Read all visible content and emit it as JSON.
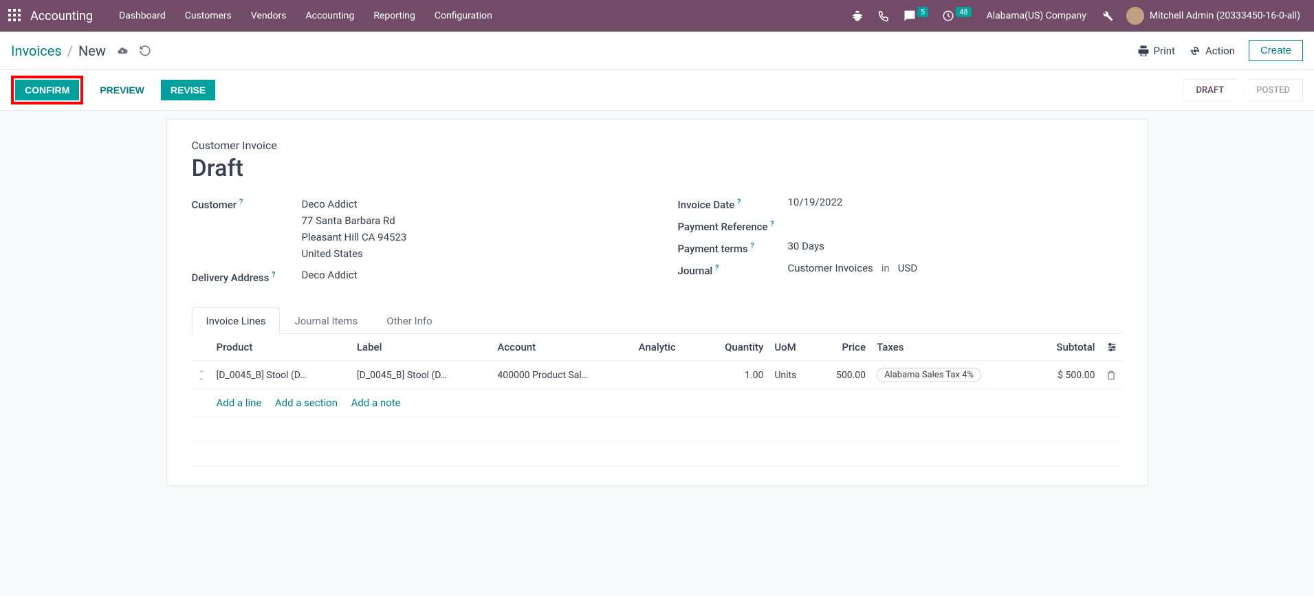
{
  "navbar": {
    "brand": "Accounting",
    "menus": [
      "Dashboard",
      "Customers",
      "Vendors",
      "Accounting",
      "Reporting",
      "Configuration"
    ],
    "messages_count": "5",
    "activities_count": "48",
    "company": "Alabama(US) Company",
    "user": "Mitchell Admin (20333450-16-0-all)"
  },
  "breadcrumb": {
    "back": "Invoices",
    "current": "New"
  },
  "control": {
    "print": "Print",
    "action": "Action",
    "create": "Create"
  },
  "statusbar": {
    "confirm": "CONFIRM",
    "preview": "PREVIEW",
    "revise": "REVISE",
    "draft": "DRAFT",
    "posted": "POSTED"
  },
  "form": {
    "move_type": "Customer Invoice",
    "name": "Draft",
    "labels": {
      "customer": "Customer",
      "delivery": "Delivery Address",
      "invoice_date": "Invoice Date",
      "payment_ref": "Payment Reference",
      "payment_terms": "Payment terms",
      "journal": "Journal",
      "in": "in"
    },
    "customer": {
      "name": "Deco Addict",
      "street": "77 Santa Barbara Rd",
      "city": "Pleasant Hill CA 94523",
      "country": "United States"
    },
    "delivery": "Deco Addict",
    "invoice_date": "10/19/2022",
    "payment_ref": "",
    "payment_terms": "30 Days",
    "journal": "Customer Invoices",
    "currency": "USD"
  },
  "tabs": [
    "Invoice Lines",
    "Journal Items",
    "Other Info"
  ],
  "columns": {
    "product": "Product",
    "label": "Label",
    "account": "Account",
    "analytic": "Analytic",
    "quantity": "Quantity",
    "uom": "UoM",
    "price": "Price",
    "taxes": "Taxes",
    "subtotal": "Subtotal"
  },
  "lines": [
    {
      "product": "[D_0045_B] Stool (D…",
      "label": "[D_0045_B] Stool (D…",
      "account": "400000 Product Sal…",
      "analytic": "",
      "quantity": "1.00",
      "uom": "Units",
      "price": "500.00",
      "tax": "Alabama Sales Tax 4%",
      "subtotal": "$ 500.00"
    }
  ],
  "actions": {
    "add_line": "Add a line",
    "add_section": "Add a section",
    "add_note": "Add a note"
  }
}
